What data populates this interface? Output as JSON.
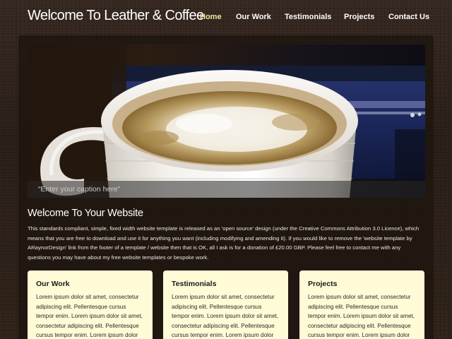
{
  "header": {
    "site_title": "Welcome To Leather & Coffee",
    "nav": [
      {
        "label": "Home",
        "active": true
      },
      {
        "label": "Our Work",
        "active": false
      },
      {
        "label": "Testimonials",
        "active": false
      },
      {
        "label": "Projects",
        "active": false
      },
      {
        "label": "Contact Us",
        "active": false
      }
    ]
  },
  "banner": {
    "caption": "“Enter your caption here”"
  },
  "welcome": {
    "heading": "Welcome To Your Website",
    "text": "This standards compliant, simple, fixed width website template is released as an 'open source' design (under the Creative Commons Attribution 3.0 Licence), which means that you are free to download and use it for anything you want (including modifying and amending it). If you would like to remove the 'website template by ARaynorDesign' link from the footer of a template / website then that is OK, all I ask is for a donation of £20.00 GBP. Please feel free to contact me with any questions you may have about my free website templates or bespoke work."
  },
  "cards": [
    {
      "title": "Our Work",
      "text": "Lorem ipsum dolor sit amet, consectetur adipiscing elit. Pellentesque cursus tempor enim. Lorem ipsum dolor sit amet, consectetur adipiscing elit. Pellentesque cursus tempor enim. Lorem ipsum dolor"
    },
    {
      "title": "Testimonials",
      "text": "Lorem ipsum dolor sit amet, consectetur adipiscing elit. Pellentesque cursus tempor enim. Lorem ipsum dolor sit amet, consectetur adipiscing elit. Pellentesque cursus tempor enim. Lorem ipsum dolor sit"
    },
    {
      "title": "Projects",
      "text": "Lorem ipsum dolor sit amet, consectetur adipiscing elit. Pellentesque cursus tempor enim. Lorem ipsum dolor sit amet, consectetur adipiscing elit. Pellentesque cursus tempor enim. Lorem ipsum dolor sit"
    }
  ],
  "colors": {
    "background": "#2b2018",
    "nav_active": "#f2e49e",
    "card_background": "#fefbd6"
  }
}
